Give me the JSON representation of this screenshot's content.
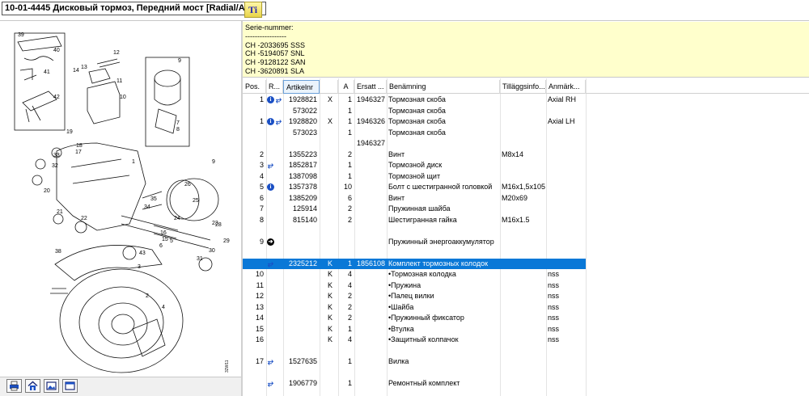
{
  "title": "10-01-4445 Дисковый тормоз, Передний мост [Radial/Axial]",
  "serial": {
    "heading": "Serie-nummer:",
    "separator": "-----------------",
    "lines": [
      "CH -2033695 SSS",
      "CH -5194057 SNL",
      "CH -9128122 SAN",
      "CH -3620891 SLA"
    ]
  },
  "columns": {
    "pos": "Pos.",
    "r": "R...",
    "artikelnr": "Artikelnr",
    "a": "A",
    "ersatt": "Ersatt ...",
    "benamning": "Benämning",
    "tillagg": "Tilläggsinfo...",
    "anmark": "Anmärk..."
  },
  "rows": [
    {
      "pos": "1",
      "icons": [
        "info",
        "sub"
      ],
      "art": "1928821",
      "r2": "X",
      "a": "1",
      "ersatt": "1946327",
      "name": "Тормозная скоба",
      "info": "",
      "note": "Axial RH"
    },
    {
      "pos": "",
      "icons": [],
      "art": "573022",
      "r2": "",
      "a": "1",
      "ersatt": "",
      "name": "Тормозная скоба",
      "info": "",
      "note": ""
    },
    {
      "pos": "1",
      "icons": [
        "info",
        "sub"
      ],
      "art": "1928820",
      "r2": "X",
      "a": "1",
      "ersatt": "1946326",
      "name": "Тормозная скоба",
      "info": "",
      "note": "Axial LH"
    },
    {
      "pos": "",
      "icons": [],
      "art": "573023",
      "r2": "",
      "a": "1",
      "ersatt": "",
      "name": "Тормозная скоба",
      "info": "",
      "note": ""
    },
    {
      "pos": "",
      "icons": [],
      "art": "",
      "r2": "",
      "a": "",
      "ersatt": "1946327",
      "name": "",
      "info": "",
      "note": ""
    },
    {
      "pos": "2",
      "icons": [],
      "art": "1355223",
      "r2": "",
      "a": "2",
      "ersatt": "",
      "name": "Винт",
      "info": "M8x14",
      "note": ""
    },
    {
      "pos": "3",
      "icons": [
        "sub"
      ],
      "art": "1852817",
      "r2": "",
      "a": "1",
      "ersatt": "",
      "name": "Тормозной диск",
      "info": "",
      "note": ""
    },
    {
      "pos": "4",
      "icons": [],
      "art": "1387098",
      "r2": "",
      "a": "1",
      "ersatt": "",
      "name": "Тормозной щит",
      "info": "",
      "note": ""
    },
    {
      "pos": "5",
      "icons": [
        "info"
      ],
      "art": "1357378",
      "r2": "",
      "a": "10",
      "ersatt": "",
      "name": "Болт с шестигранной головкой",
      "info": "M16x1,5x105",
      "note": ""
    },
    {
      "pos": "6",
      "icons": [],
      "art": "1385209",
      "r2": "",
      "a": "6",
      "ersatt": "",
      "name": "Винт",
      "info": "M20x69",
      "note": ""
    },
    {
      "pos": "7",
      "icons": [],
      "art": "125914",
      "r2": "",
      "a": "2",
      "ersatt": "",
      "name": "Пружинная шайба",
      "info": "",
      "note": ""
    },
    {
      "pos": "8",
      "icons": [],
      "art": "815140",
      "r2": "",
      "a": "2",
      "ersatt": "",
      "name": "Шестигранная гайка",
      "info": "M16x1.5",
      "note": ""
    },
    {
      "pos": "",
      "icons": [],
      "art": "",
      "r2": "",
      "a": "",
      "ersatt": "",
      "name": "",
      "info": "",
      "note": ""
    },
    {
      "pos": "9",
      "icons": [
        "arrow"
      ],
      "art": "",
      "r2": "",
      "a": "",
      "ersatt": "",
      "name": "Пружинный энергоаккумулятор",
      "info": "",
      "note": ""
    },
    {
      "pos": "",
      "icons": [],
      "art": "",
      "r2": "",
      "a": "",
      "ersatt": "",
      "name": "",
      "info": "",
      "note": ""
    },
    {
      "pos": "",
      "icons": [
        "sub"
      ],
      "art": "2325212",
      "r2": "K",
      "a": "1",
      "ersatt": "1856108",
      "name": "Комплект тормозных колодок",
      "info": "",
      "note": "",
      "selected": true
    },
    {
      "pos": "10",
      "icons": [],
      "art": "",
      "r2": "K",
      "a": "4",
      "ersatt": "",
      "name": "•Тормозная колодка",
      "info": "",
      "note": "nss"
    },
    {
      "pos": "11",
      "icons": [],
      "art": "",
      "r2": "K",
      "a": "4",
      "ersatt": "",
      "name": "•Пружина",
      "info": "",
      "note": "nss"
    },
    {
      "pos": "12",
      "icons": [],
      "art": "",
      "r2": "K",
      "a": "2",
      "ersatt": "",
      "name": "•Палец вилки",
      "info": "",
      "note": "nss"
    },
    {
      "pos": "13",
      "icons": [],
      "art": "",
      "r2": "K",
      "a": "2",
      "ersatt": "",
      "name": "•Шайба",
      "info": "",
      "note": "nss"
    },
    {
      "pos": "14",
      "icons": [],
      "art": "",
      "r2": "K",
      "a": "2",
      "ersatt": "",
      "name": "•Пружинный фиксатор",
      "info": "",
      "note": "nss"
    },
    {
      "pos": "15",
      "icons": [],
      "art": "",
      "r2": "K",
      "a": "1",
      "ersatt": "",
      "name": "•Втулка",
      "info": "",
      "note": "nss"
    },
    {
      "pos": "16",
      "icons": [],
      "art": "",
      "r2": "K",
      "a": "4",
      "ersatt": "",
      "name": "•Защитный колпачок",
      "info": "",
      "note": "nss"
    },
    {
      "pos": "",
      "icons": [],
      "art": "",
      "r2": "",
      "a": "",
      "ersatt": "",
      "name": "",
      "info": "",
      "note": ""
    },
    {
      "pos": "17",
      "icons": [
        "sub"
      ],
      "art": "1527635",
      "r2": "",
      "a": "1",
      "ersatt": "",
      "name": "Вилка",
      "info": "",
      "note": ""
    },
    {
      "pos": "",
      "icons": [],
      "art": "",
      "r2": "",
      "a": "",
      "ersatt": "",
      "name": "",
      "info": "",
      "note": ""
    },
    {
      "pos": "",
      "icons": [
        "sub"
      ],
      "art": "1906779",
      "r2": "",
      "a": "1",
      "ersatt": "",
      "name": "Ремонтный комплект",
      "info": "",
      "note": ""
    }
  ],
  "diagram": {
    "callouts": [
      "39",
      "40",
      "41",
      "42",
      "14",
      "13",
      "12",
      "11",
      "10",
      "9",
      "8",
      "7",
      "19",
      "33",
      "32",
      "18",
      "17",
      "1",
      "35",
      "2",
      "34",
      "16",
      "22",
      "20",
      "21",
      "26",
      "25",
      "24",
      "23",
      "43",
      "15",
      "6",
      "5",
      "28",
      "29",
      "30",
      "31",
      "38",
      "3",
      "4",
      "9"
    ],
    "code": "32W11"
  },
  "toolbar": {
    "buttons": [
      "print-icon",
      "home-icon",
      "image-icon",
      "window-icon"
    ]
  },
  "colors": {
    "selected_row": "#0a78d7",
    "serial_bg": "#ffffcc",
    "info_icon": "#1a4fc4"
  }
}
